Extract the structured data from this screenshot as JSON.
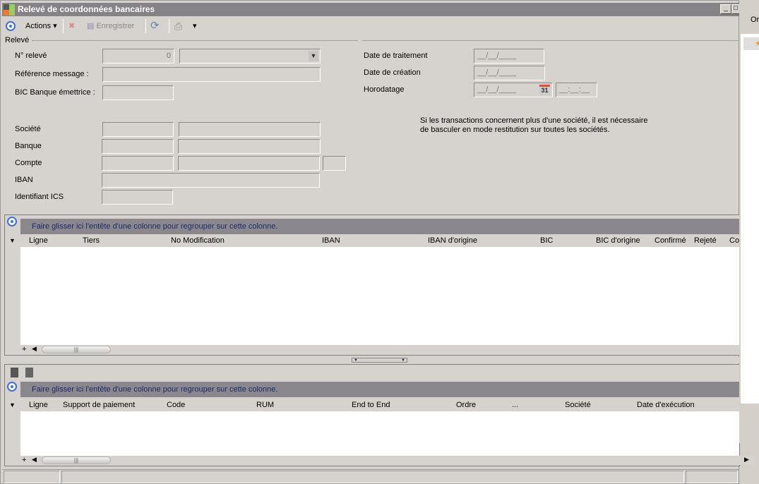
{
  "window": {
    "title": "Relevé de coordonnées bancaires",
    "minimize": "_",
    "maximize": "□"
  },
  "toolbar": {
    "actions": "Actions",
    "save": "Enregistrer"
  },
  "side_panel": {
    "label": "Or"
  },
  "form": {
    "section": "Relevé",
    "num_releve_label": "N° relevé",
    "num_releve_value": "0",
    "ref_message_label": "Référence message :",
    "bic_label": "BIC Banque émettrice :",
    "societe_label": "Société",
    "banque_label": "Banque",
    "compte_label": "Compte",
    "iban_label": "IBAN",
    "ics_label": "Identifiant ICS",
    "date_traitement_label": "Date de traitement",
    "date_creation_label": "Date de création",
    "horodatage_label": "Horodatage",
    "date_placeholder": "__/__/____",
    "time_placeholder": "__:__:__",
    "calendar_day": "31",
    "note_line1": "Si les transactions concernent plus d'une société, il est nécessaire",
    "note_line2": "de basculer en mode restitution sur toutes les sociétés."
  },
  "grid1": {
    "group_hint": "Faire glisser ici l'entête d'une colonne pour regrouper sur cette colonne.",
    "columns": [
      "Ligne",
      "Tiers",
      "No Modification",
      "IBAN",
      "IBAN d'origine",
      "BIC",
      "BIC d'origine",
      "Confirmé",
      "Rejeté",
      "Co"
    ]
  },
  "grid2": {
    "group_hint": "Faire glisser ici l'entête d'une colonne pour regrouper sur cette colonne.",
    "columns": [
      "Ligne",
      "Support de paiement",
      "Code",
      "RUM",
      "End to End",
      "Ordre",
      "...",
      "Société",
      "Date d'exécution"
    ]
  },
  "scroll": {
    "add": "+",
    "grip": "|||"
  }
}
